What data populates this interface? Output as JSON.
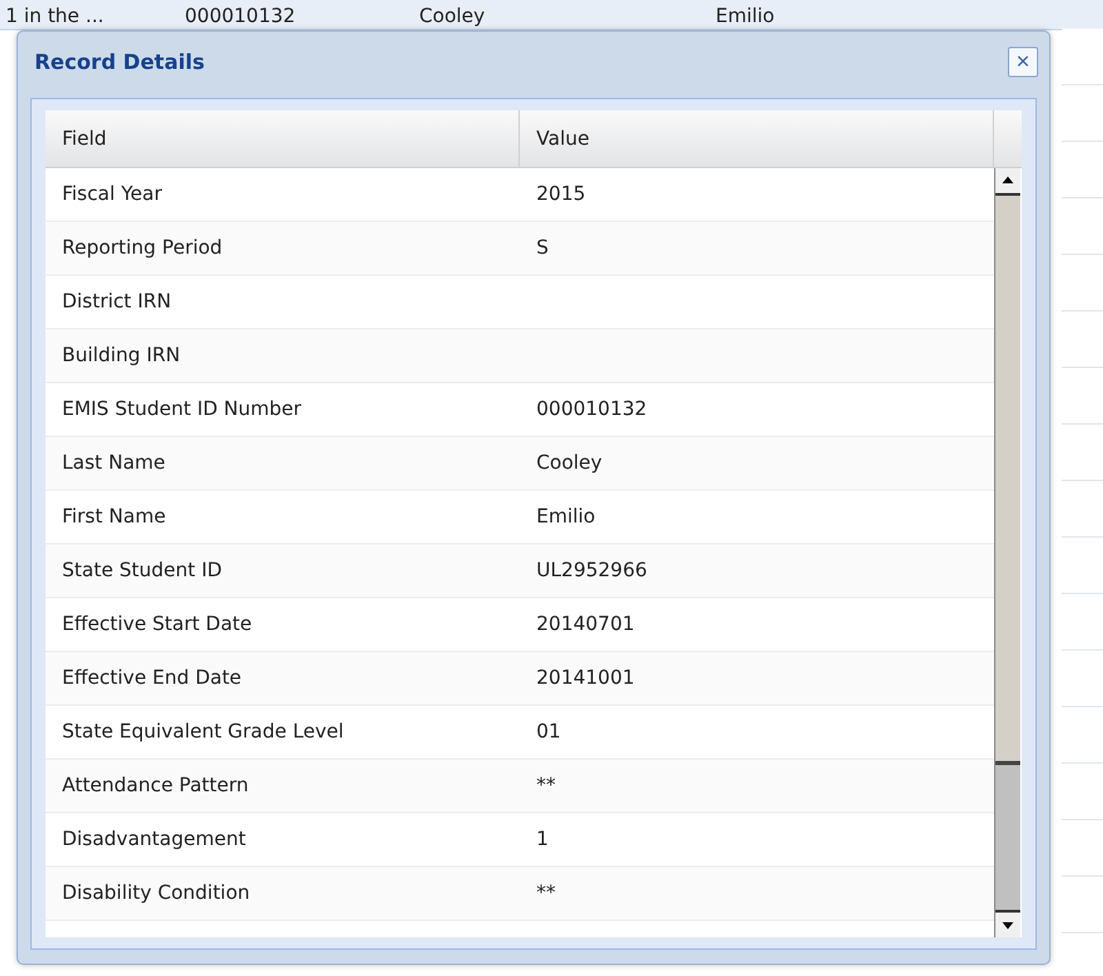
{
  "background_row": {
    "cells": [
      "1 in the ...",
      "000010132",
      "Cooley",
      "Emilio"
    ]
  },
  "dialog": {
    "title": "Record Details",
    "close": "×"
  },
  "grid": {
    "columns": [
      "Field",
      "Value"
    ],
    "rows": [
      {
        "field": "Fiscal Year",
        "value": "2015"
      },
      {
        "field": "Reporting Period",
        "value": "S"
      },
      {
        "field": "District IRN"
      },
      {
        "field": "Building IRN"
      },
      {
        "field": "EMIS Student ID Number",
        "value": "000010132"
      },
      {
        "field": "Last Name",
        "value": "Cooley"
      },
      {
        "field": "First Name",
        "value": "Emilio"
      },
      {
        "field": "State Student ID",
        "value": "UL2952966"
      },
      {
        "field": "Effective Start Date",
        "value": "20140701"
      },
      {
        "field": "Effective End Date",
        "value": "20141001"
      },
      {
        "field": "State Equivalent Grade Level",
        "value": "01"
      },
      {
        "field": "Attendance Pattern",
        "value": "**"
      },
      {
        "field": "Disadvantagement",
        "value": "1"
      },
      {
        "field": "Disability Condition",
        "value": "**"
      }
    ]
  }
}
